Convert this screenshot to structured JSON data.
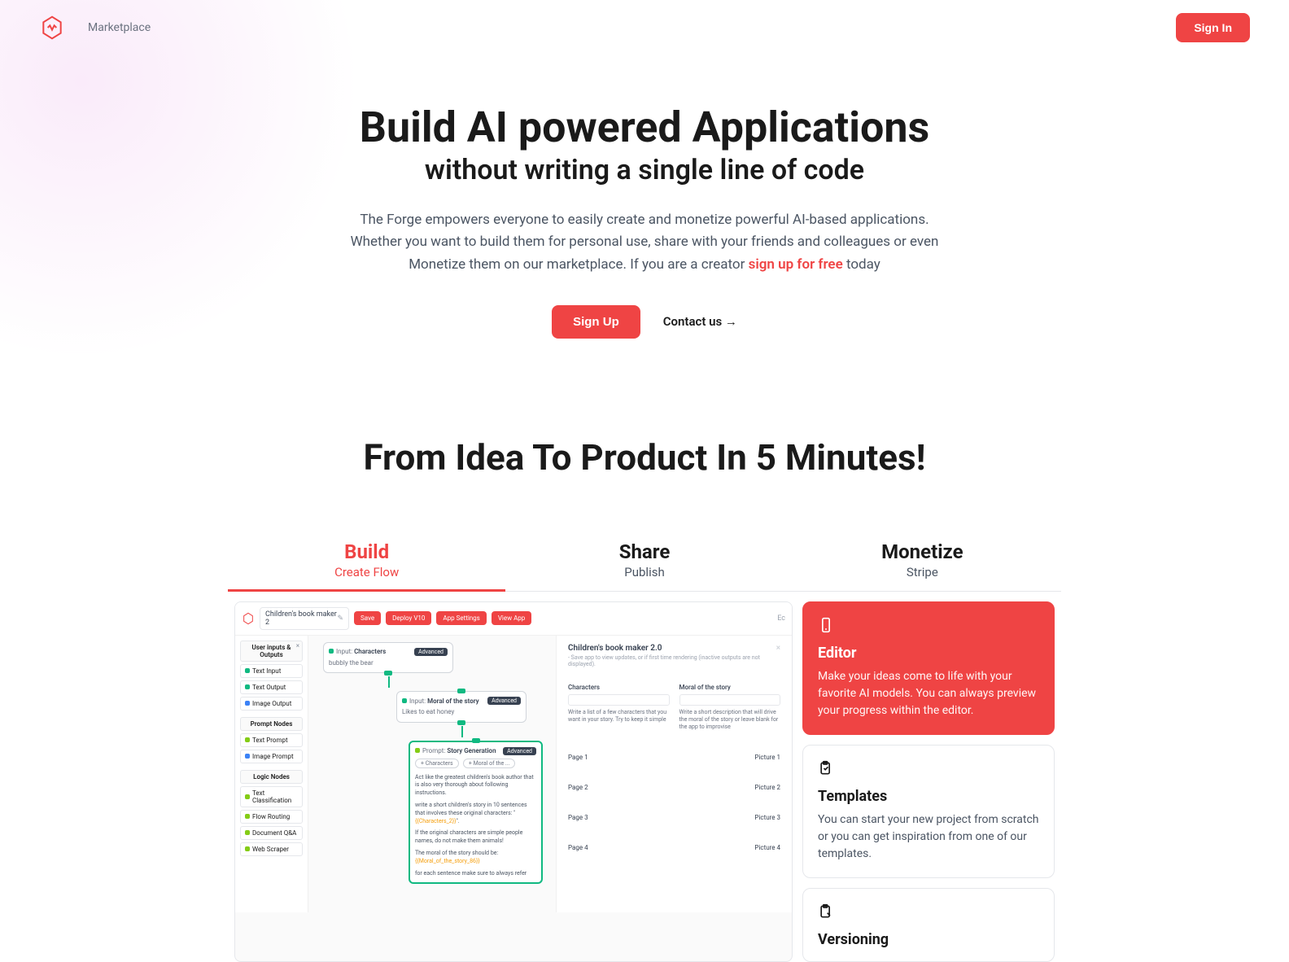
{
  "header": {
    "nav_marketplace": "Marketplace",
    "signin": "Sign In"
  },
  "hero": {
    "title": "Build AI powered Applications",
    "subtitle": "without writing a single line of code",
    "desc_before": "The Forge empowers everyone to easily create and monetize powerful AI-based applications. Whether you want to build them for personal use, share with your friends and colleagues or even Monetize them on our marketplace. If you are a creator ",
    "signup_link": "sign up for free",
    "desc_after": " today",
    "signup_btn": "Sign Up",
    "contact": "Contact us →"
  },
  "section_title": "From Idea To Product In 5 Minutes!",
  "tabs": [
    {
      "title": "Build",
      "sub": "Create Flow"
    },
    {
      "title": "Share",
      "sub": "Publish"
    },
    {
      "title": "Monetize",
      "sub": "Stripe"
    }
  ],
  "mock": {
    "app_title": "Children's book maker 2",
    "btns": [
      "Save",
      "Deploy V10",
      "App Settings",
      "View App"
    ],
    "toolbar_right": "Ec",
    "sidebar": {
      "groups": [
        {
          "header": "User inputs & Outputs",
          "items": [
            {
              "label": "Text Input",
              "dot": "green"
            },
            {
              "label": "Text Output",
              "dot": "green"
            },
            {
              "label": "Image Output",
              "dot": "blue"
            }
          ]
        },
        {
          "header": "Prompt Nodes",
          "items": [
            {
              "label": "Text Prompt",
              "dot": "lgreen"
            },
            {
              "label": "Image Prompt",
              "dot": "blue"
            }
          ]
        },
        {
          "header": "Logic Nodes",
          "items": [
            {
              "label": "Text Classification",
              "dot": "lgreen"
            },
            {
              "label": "Flow Routing",
              "dot": "lgreen"
            },
            {
              "label": "Document Q&A",
              "dot": "lgreen"
            },
            {
              "label": "Web Scraper",
              "dot": "lgreen"
            }
          ]
        }
      ]
    },
    "nodes": {
      "n1_prefix": "Input:",
      "n1_name": "Characters",
      "n1_badge": "Advanced",
      "n1_body": "bubbly the bear",
      "n2_prefix": "Input:",
      "n2_name": "Moral of the story",
      "n2_badge": "Advanced",
      "n2_body": "Likes to eat honey",
      "n3_prefix": "Prompt:",
      "n3_name": "Story Generation",
      "n3_badge": "Advanced",
      "n3_pills": [
        "+ Characters",
        "+ Moral of the ..."
      ],
      "n3_text1": "Act like the greatest children's book author that is also very thorough about following instructions.",
      "n3_text2a": "write a short children's story in 10 sentences that involves these original characters: \"",
      "n3_text2b": "{{Characters_2}}",
      "n3_text2c": "\".",
      "n3_text3": "If the original characters are simple people names, do not make them animals!",
      "n3_text4a": "The moral of the story should be: ",
      "n3_text4b": "{{Moral_of_the_story_86}}",
      "n3_text5": "for each sentence make sure to always refer"
    },
    "preview": {
      "title": "Children's book maker 2.0",
      "sub": "- Save app to view updates, or if first time rendering (inactive outputs are not displayed).",
      "col1_label": "Characters",
      "col1_help": "Write a list of a few characters that you want in your story. Try to keep it simple",
      "col2_label": "Moral of the story",
      "col2_help": "Write a short description that will drive the moral of the story or leave blank for the app to improvise",
      "pages": [
        {
          "l": "Page 1",
          "r": "Picture 1"
        },
        {
          "l": "Page 2",
          "r": "Picture 2"
        },
        {
          "l": "Page 3",
          "r": "Picture 3"
        },
        {
          "l": "Page 4",
          "r": "Picture 4"
        }
      ]
    }
  },
  "features": [
    {
      "title": "Editor",
      "desc": "Make your ideas come to life with your favorite AI models. You can always preview your progress within the editor."
    },
    {
      "title": "Templates",
      "desc": "You can start your new project from scratch or you can get inspiration from one of our templates."
    },
    {
      "title": "Versioning",
      "desc": ""
    }
  ]
}
